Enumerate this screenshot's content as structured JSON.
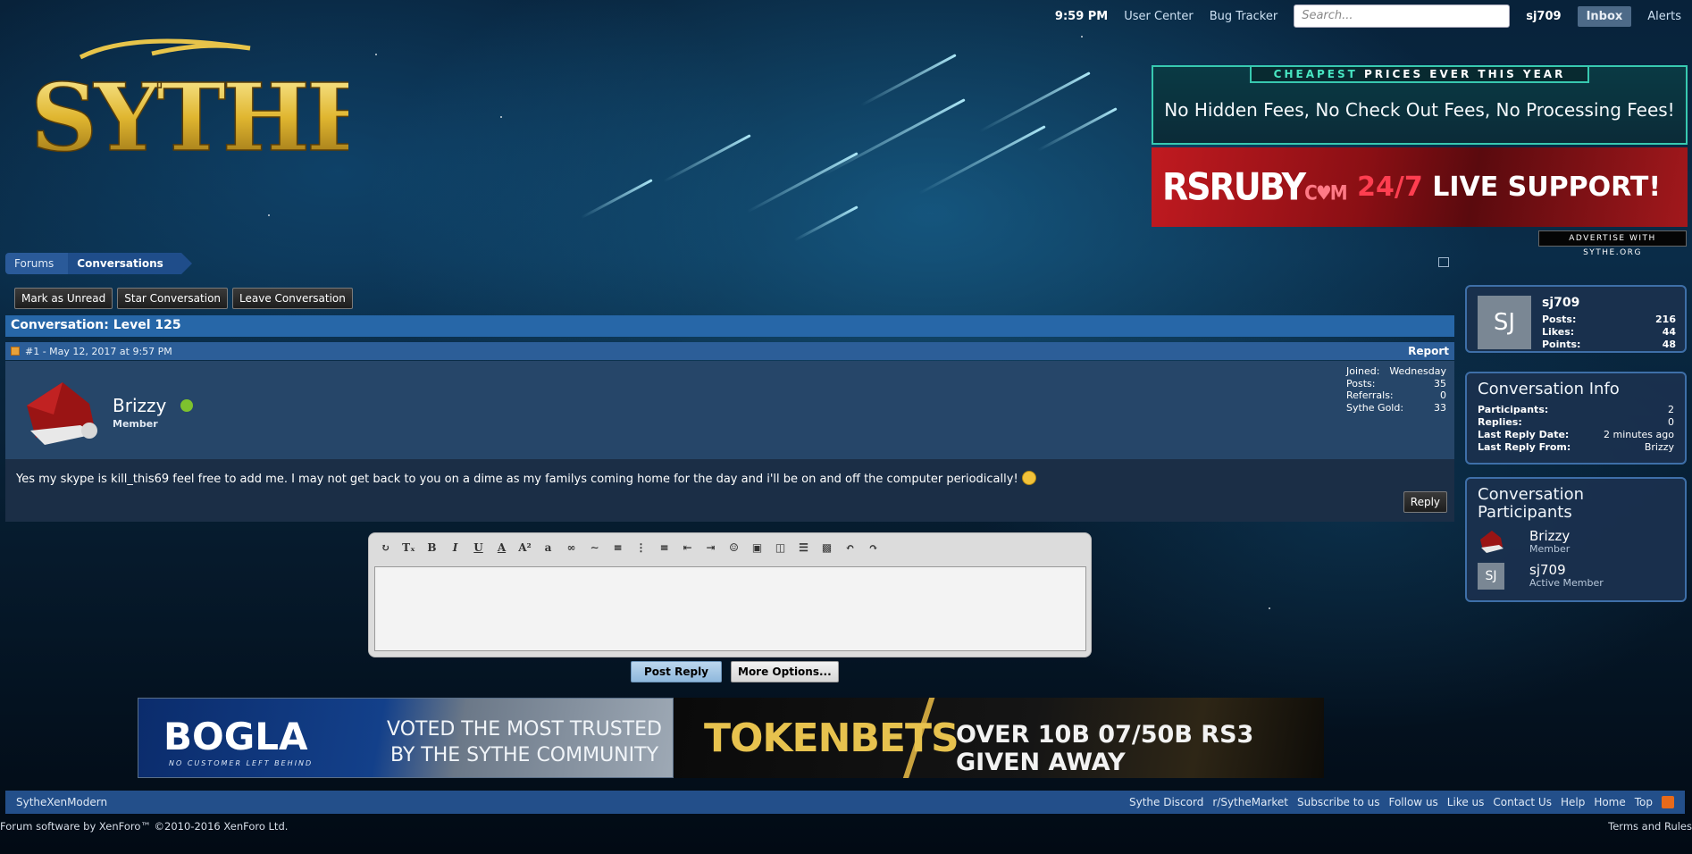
{
  "topbar": {
    "time": "9:59 PM",
    "user_center": "User Center",
    "bug_tracker": "Bug Tracker",
    "search_placeholder": "Search...",
    "username": "sj709",
    "inbox": "Inbox",
    "alerts": "Alerts"
  },
  "logo": {
    "text": "SYTHE"
  },
  "ads": {
    "top1": {
      "headline_highlight": "CHEAPEST",
      "headline_rest": "PRICES EVER THIS YEAR",
      "body": "No Hidden Fees, No Check Out Fees, No Processing Fees!"
    },
    "top2": {
      "brand": "RSRUBY",
      "brand_suffix": "C♥M",
      "slogan_number": "24/7",
      "slogan_rest": "LIVE SUPPORT!"
    },
    "advertise": "ADVERTISE WITH SYTHE.ORG",
    "bottom1": {
      "brand": "BOGLA",
      "sub": "NO CUSTOMER LEFT BEHIND",
      "tag": "VOTED THE MOST TRUSTED BY THE SYTHE COMMUNITY"
    },
    "bottom2": {
      "brand": "TOKENBETS",
      "tag": "OVER 10B 07/50B RS3 GIVEN AWAY"
    }
  },
  "breadcrumb": [
    "Forums",
    "Conversations"
  ],
  "actions": {
    "mark_unread": "Mark as Unread",
    "star": "Star Conversation",
    "leave": "Leave Conversation"
  },
  "conversation": {
    "title": "Conversation: Level 125",
    "post": {
      "number_date": "#1 - May 12, 2017 at 9:57 PM",
      "report": "Report",
      "author": "Brizzy",
      "role": "Member",
      "stats": [
        {
          "label": "Joined:",
          "value": "Wednesday"
        },
        {
          "label": "Posts:",
          "value": "35"
        },
        {
          "label": "Referrals:",
          "value": "0"
        },
        {
          "label": "Sythe Gold:",
          "value": "33"
        }
      ],
      "body": "Yes my skype is kill_this69 feel free to add me. I may not get back to you on a dime as my familys coming home for the day and i'll be on and off the computer periodically!",
      "reply": "Reply"
    }
  },
  "editor": {
    "post_reply": "Post Reply",
    "more_options": "More Options..."
  },
  "footer": {
    "style": "SytheXenModern",
    "links": [
      "Sythe Discord",
      "r/SytheMarket",
      "Subscribe to us",
      "Follow us",
      "Like us",
      "Contact Us",
      "Help",
      "Home",
      "Top"
    ],
    "copyright": "Forum software by XenForo™ ©2010-2016 XenForo Ltd.",
    "terms": "Terms and Rules"
  },
  "sidebar": {
    "user": {
      "avatar_initials": "SJ",
      "name": "sj709",
      "stats": [
        {
          "label": "Posts:",
          "value": "216"
        },
        {
          "label": "Likes:",
          "value": "44"
        },
        {
          "label": "Points:",
          "value": "48"
        }
      ]
    },
    "info": {
      "title": "Conversation Info",
      "rows": [
        {
          "label": "Participants:",
          "value": "2"
        },
        {
          "label": "Replies:",
          "value": "0"
        },
        {
          "label": "Last Reply Date:",
          "value": "2 minutes ago"
        },
        {
          "label": "Last Reply From:",
          "value": "Brizzy"
        }
      ]
    },
    "participants": {
      "title": "Conversation Participants",
      "list": [
        {
          "name": "Brizzy",
          "role": "Member"
        },
        {
          "name": "sj709",
          "role": "Active Member",
          "initials": "SJ"
        }
      ]
    }
  }
}
